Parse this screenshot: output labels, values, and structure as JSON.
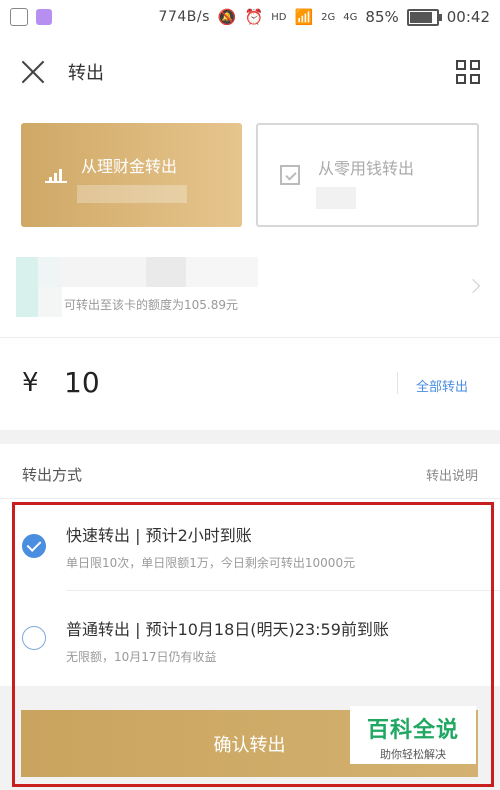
{
  "status_bar": {
    "net_speed": "774B/s",
    "signal_2g": "2G",
    "signal_4g": "4G",
    "hd_label": "HD",
    "battery": "85%",
    "time": "00:42"
  },
  "header": {
    "title": "转出"
  },
  "source_cards": {
    "wealth": {
      "label": "从理财金转出"
    },
    "change": {
      "label": "从零用钱转出"
    }
  },
  "bank_card": {
    "limit_text": "可转出至该卡的额度为105.89元"
  },
  "amount": {
    "currency": "¥",
    "value": "10",
    "all_out": "全部转出"
  },
  "method": {
    "heading": "转出方式",
    "help": "转出说明",
    "options": [
      {
        "title": "快速转出 | 预计2小时到账",
        "desc": "单日限10次，单日限额1万，今日剩余可转出10000元",
        "selected": true
      },
      {
        "title": "普通转出 | 预计10月18日(明天)23:59前到账",
        "desc": "无限额，10月17日仍有收益",
        "selected": false
      }
    ]
  },
  "confirm_label": "确认转出",
  "watermark": {
    "brand": "百科全说",
    "slogan": "助你轻松解决"
  },
  "colors": {
    "gold": "#cfa866",
    "accent_blue": "#4a8ee0",
    "highlight_red": "#c81e1e",
    "watermark_green": "#20a862"
  }
}
